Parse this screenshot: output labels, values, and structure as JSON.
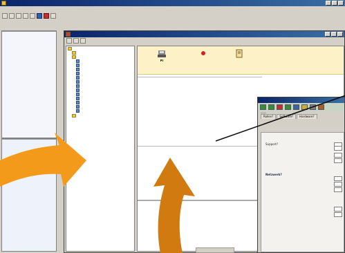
{
  "colors": {
    "titlebar_start": "#0a246a",
    "titlebar_end": "#3a6ea5",
    "window_bg": "#d4d0c8",
    "highlight_rows": "#f6c8a4",
    "arrow_light": "#f39a1a",
    "arrow_dark": "#d07a10",
    "link_text": "#1a3a90"
  },
  "main_window": {
    "title": "",
    "menu": [
      "",
      "",
      "",
      "",
      "",
      "",
      "",
      "",
      ""
    ],
    "toolbar_icons": [
      "new-icon",
      "open-icon",
      "save-icon",
      "print-icon",
      "cut-icon",
      "settings-icon",
      "delete-icon",
      "help-icon"
    ]
  },
  "left_pane": {
    "top_header": "",
    "top_row": "",
    "bottom_header": ""
  },
  "sub_window": {
    "title": "",
    "tree": {
      "root": "",
      "children": [
        "",
        "",
        "",
        "",
        "",
        "",
        "",
        "",
        "",
        "",
        "",
        "",
        "",
        "",
        ""
      ],
      "footer": ""
    },
    "actions": [
      {
        "label": "",
        "icon": "scanner-icon"
      },
      {
        "label": "",
        "icon": "stop-icon"
      },
      {
        "label": "",
        "icon": "document-icon"
      }
    ],
    "table1": {
      "header": "",
      "rows": [
        {
          "date": "",
          "text": ""
        },
        {
          "date": "",
          "text": ""
        },
        {
          "date": "",
          "text": ""
        },
        {
          "date": "",
          "text": ""
        },
        {
          "date": "",
          "text": ""
        },
        {
          "date": "",
          "text": ""
        },
        {
          "date": "",
          "text": ""
        },
        {
          "date": "",
          "text": ""
        }
      ]
    },
    "table2": {
      "header": "",
      "rows": [
        {
          "date": "",
          "text": ""
        },
        {
          "date": "",
          "text": ""
        },
        {
          "date": "",
          "text": ""
        },
        {
          "date": "",
          "text": ""
        }
      ]
    },
    "log": {
      "header": "",
      "lines": [
        "",
        "",
        "",
        "",
        "",
        "",
        "",
        ""
      ]
    },
    "status": ""
  },
  "config_dialog": {
    "tabs": [
      "",
      "Rollen?",
      "",
      "Software?",
      "Hardware?"
    ],
    "title": "",
    "fields1": [
      "Support?",
      "",
      "",
      ""
    ],
    "section2_title": "Netzwerk?",
    "fields2": [
      "",
      "",
      ""
    ],
    "section3_title": "",
    "fields3": [
      "",
      ""
    ]
  }
}
